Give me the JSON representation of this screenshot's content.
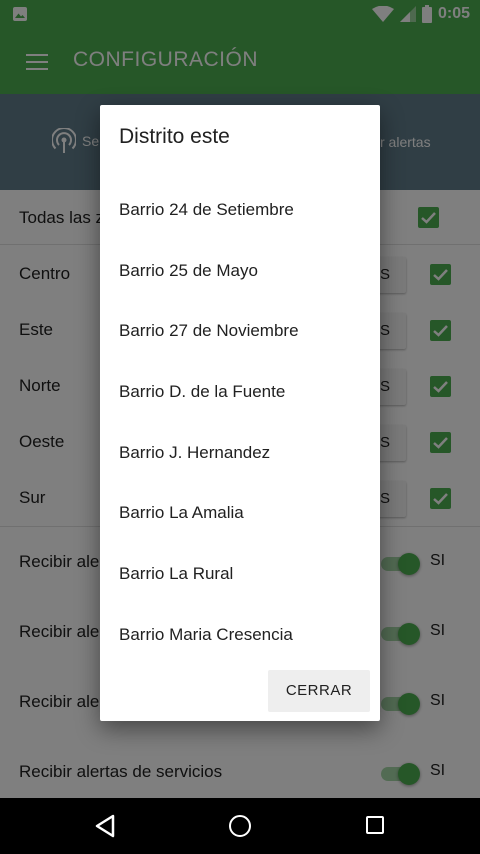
{
  "status_bar": {
    "time": "0:05"
  },
  "app_bar": {
    "title": "CONFIGURACIÓN"
  },
  "tabs": {
    "left_label": "Se",
    "right_label": "r alertas"
  },
  "settings": {
    "all_zones_label": "Todas las z",
    "zones": [
      {
        "label": "Centro",
        "button": "S"
      },
      {
        "label": "Este",
        "button": "S"
      },
      {
        "label": "Norte",
        "button": "S"
      },
      {
        "label": "Oeste",
        "button": "S"
      },
      {
        "label": "Sur",
        "button": "S"
      }
    ],
    "alerts": [
      {
        "label": "Recibir ale",
        "state": "SI"
      },
      {
        "label": "Recibir ale",
        "state": "SI"
      },
      {
        "label": "Recibir ale",
        "state": "SI"
      },
      {
        "label": "Recibir alertas de servicios",
        "state": "SI"
      }
    ]
  },
  "dialog": {
    "title": "Distrito este",
    "items": [
      "Barrio 24 de Setiembre",
      "Barrio 25 de Mayo",
      "Barrio 27 de Noviembre",
      "Barrio D. de la Fuente",
      "Barrio J. Hernandez",
      "Barrio La Amalia",
      "Barrio La Rural",
      "Barrio Maria Cresencia"
    ],
    "close_label": "CERRAR"
  },
  "colors": {
    "primary": "#4caf50",
    "tab_bar": "#607d8b",
    "toggle_track": "#a5d6a7"
  }
}
